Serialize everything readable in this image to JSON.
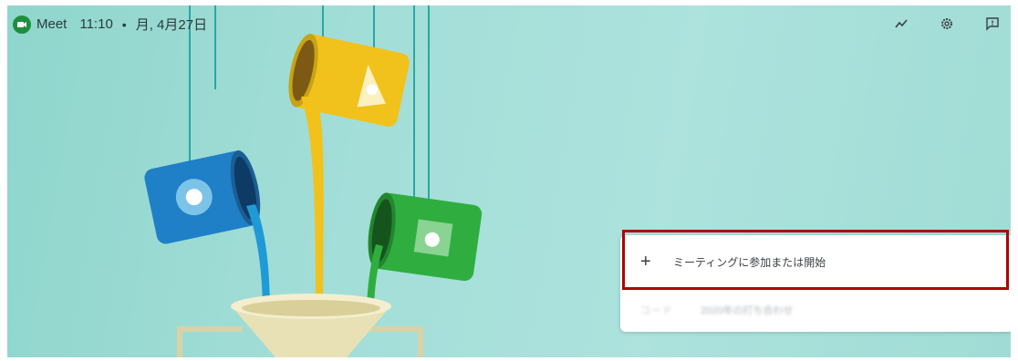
{
  "header": {
    "app_name": "Meet",
    "time": "11:10",
    "separator": "•",
    "date": "月, 4月27日"
  },
  "icons": {
    "logo": "google-meet-logo",
    "activity": "trend-line-icon",
    "settings": "gear-icon",
    "feedback": "feedback-icon"
  },
  "panel": {
    "join_label": "ミーティングに参加または開始",
    "recent_code": "コード",
    "recent_name": "2020年の打ち合わせ"
  },
  "colors": {
    "background": "#a3ded8",
    "highlight": "#b00000",
    "paint_blue": "#1f7fc7",
    "paint_yellow": "#f1c21b",
    "paint_green": "#2fae3f"
  }
}
